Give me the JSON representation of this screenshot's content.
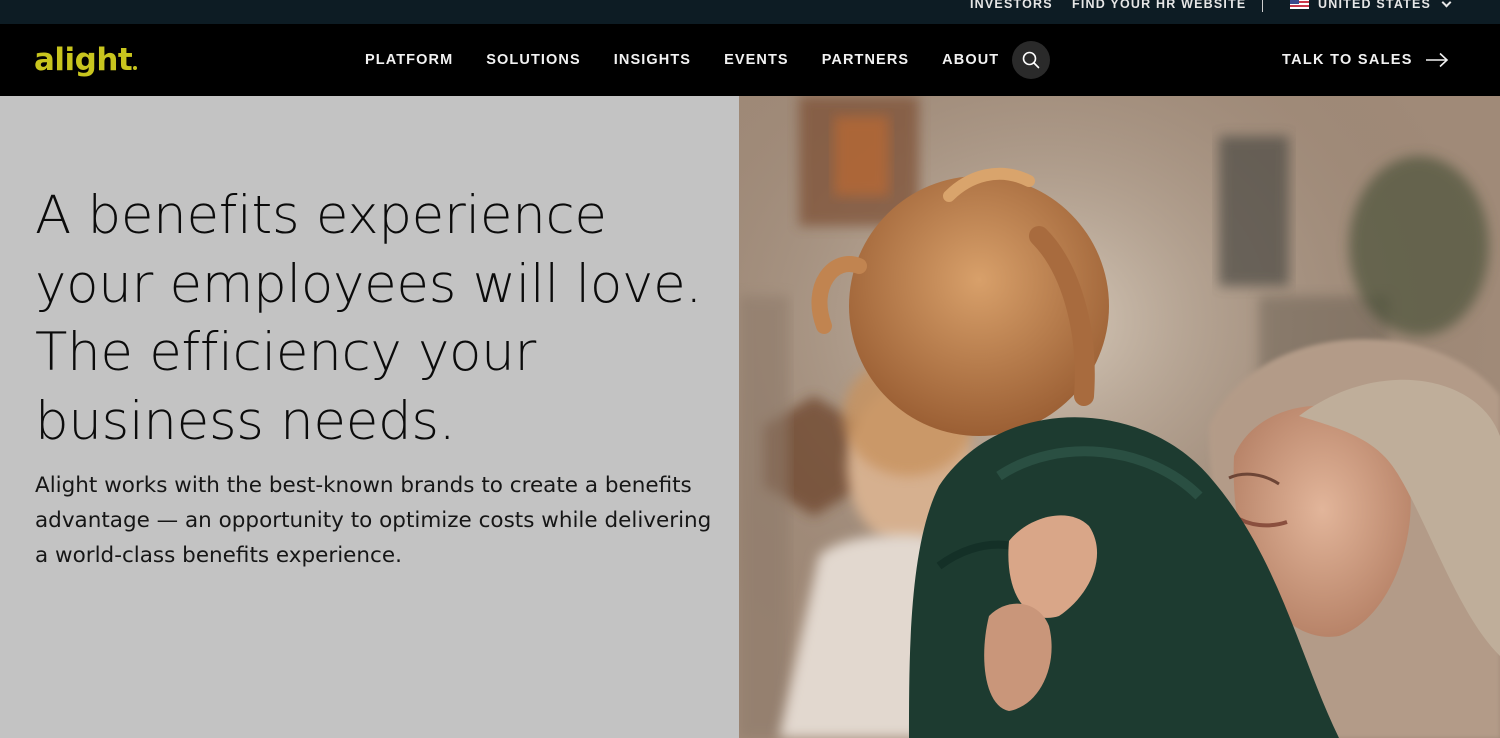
{
  "utility": {
    "investors": "INVESTORS",
    "find_hr": "FIND YOUR HR WEBSITE",
    "country": "UNITED STATES"
  },
  "nav": {
    "logo_text": "alight",
    "items": [
      {
        "label": "PLATFORM"
      },
      {
        "label": "SOLUTIONS"
      },
      {
        "label": "INSIGHTS"
      },
      {
        "label": "EVENTS"
      },
      {
        "label": "PARTNERS"
      },
      {
        "label": "ABOUT"
      }
    ],
    "cta": "TALK TO SALES"
  },
  "hero": {
    "title": "A benefits experience your employees will love. The efficiency your business needs.",
    "subtitle": "Alight works with the best-known brands to create a benefits advantage — an opportunity to optimize costs while delivering a world-class benefits experience."
  },
  "colors": {
    "brand_yellow": "#c8c51e",
    "nav_bg": "#000000",
    "utility_bg": "#0d1c24",
    "hero_bg": "#c3c3c3"
  }
}
